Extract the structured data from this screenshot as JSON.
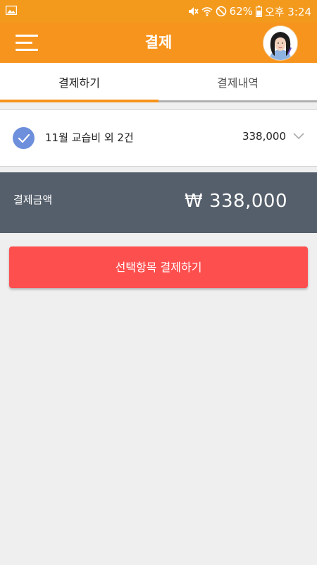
{
  "status_bar": {
    "battery": "62%",
    "time": "오후 3:24",
    "icons": [
      "image-icon",
      "mute-icon",
      "wifi-icon",
      "do-not-disturb-icon",
      "battery-icon"
    ]
  },
  "app_bar": {
    "title": "결제",
    "menu_icon": "hamburger-menu-icon",
    "profile": "avatar"
  },
  "tabs": [
    {
      "label": "결제하기",
      "active": true
    },
    {
      "label": "결제내역",
      "active": false
    }
  ],
  "payment_item": {
    "checked": true,
    "label": "11월 교습비 외 2건",
    "amount": "338,000"
  },
  "total": {
    "label": "결제금액",
    "amount": "₩ 338,000"
  },
  "pay_button": {
    "label": "선택항목 결제하기"
  },
  "colors": {
    "accent": "#f7941d",
    "total_bg": "#555f6b",
    "pay_button": "#fe4f4f",
    "check": "#6d8fdc",
    "background": "#efefef"
  }
}
